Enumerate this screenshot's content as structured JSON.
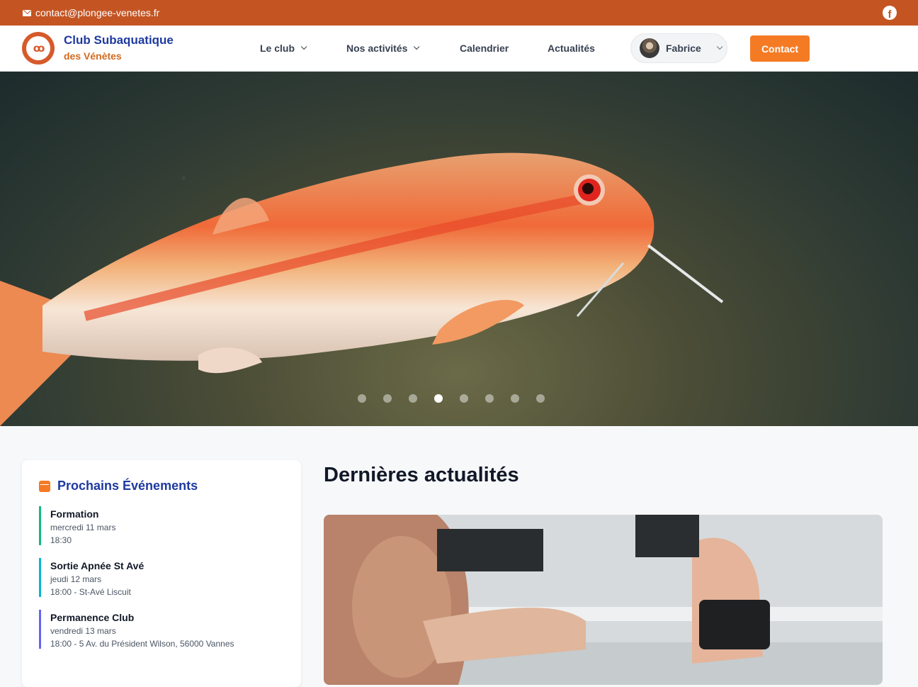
{
  "topbar": {
    "email": "contact@plongee-venetes.fr",
    "icons": [
      "mail-icon",
      "facebook-icon"
    ]
  },
  "brand": {
    "line1": "Club Subaquatique",
    "line2": "des Vénètes"
  },
  "nav": {
    "items": [
      {
        "label": "Le club",
        "dropdown": true
      },
      {
        "label": "Nos activités",
        "dropdown": true
      },
      {
        "label": "Calendrier",
        "dropdown": false
      },
      {
        "label": "Actualités",
        "dropdown": false
      }
    ],
    "user": {
      "name": "Fabrice"
    },
    "contact_label": "Contact"
  },
  "hero": {
    "slide_count": 8,
    "active_slide": 4
  },
  "events": {
    "title": "Prochains Événements",
    "items": [
      {
        "title": "Formation",
        "date": "mercredi 11 mars",
        "detail": "18:30",
        "color": "#10b981"
      },
      {
        "title": "Sortie Apnée St Avé",
        "date": "jeudi 12 mars",
        "detail": "18:00 - St-Avé Liscuit",
        "color": "#06b6d4"
      },
      {
        "title": "Permanence Club",
        "date": "vendredi 13 mars",
        "detail": "18:00 - 5 Av. du Président Wilson, 56000 Vannes",
        "color": "#6366f1"
      }
    ]
  },
  "news": {
    "title": "Dernières actualités"
  },
  "colors": {
    "topbar": "#c45523",
    "accent": "#f47b24",
    "brand_blue": "#1e3a9f",
    "brand_orange": "#d2691e"
  }
}
